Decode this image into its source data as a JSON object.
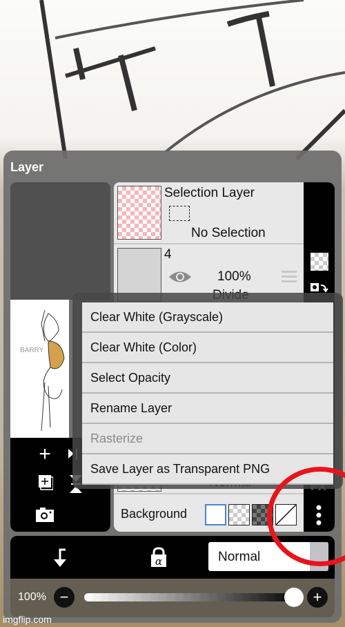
{
  "panel": {
    "title": "Layer"
  },
  "preview": {
    "label": "BARRY"
  },
  "layers": [
    {
      "name": "Selection Layer",
      "status": "No Selection",
      "type": "selection"
    },
    {
      "name": "4",
      "opacity": "100%",
      "blend": "Divide",
      "visible": true
    },
    {
      "name": "",
      "blend": "Normal"
    }
  ],
  "background": {
    "label": "Background",
    "options": [
      "white",
      "transparent-light",
      "transparent-dark",
      "none"
    ],
    "selected": "white"
  },
  "menu": {
    "items": [
      {
        "label": "Clear White (Grayscale)",
        "enabled": true
      },
      {
        "label": "Clear White (Color)",
        "enabled": true
      },
      {
        "label": "Select Opacity",
        "enabled": true
      },
      {
        "label": "Rename Layer",
        "enabled": true
      },
      {
        "label": "Rasterize",
        "enabled": false
      },
      {
        "label": "Save Layer as Transparent PNG",
        "enabled": true
      }
    ]
  },
  "side_tools": {
    "fx_label": "FX"
  },
  "bottom": {
    "blend_mode": "Normal",
    "opacity_label": "100%",
    "opacity_value": 1.0,
    "alpha_lock_glyph": "α"
  },
  "icons": {
    "minus": "−",
    "plus": "+"
  },
  "watermark": "imgflip.com",
  "annotation_color": "#e8141c"
}
